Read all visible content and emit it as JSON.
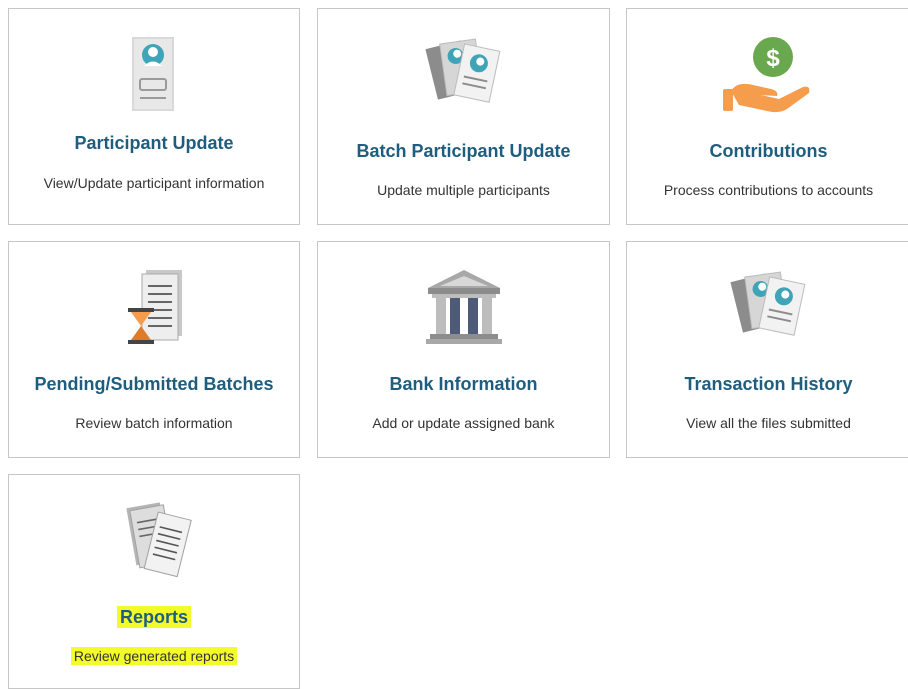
{
  "colors": {
    "title": "#1f5d7e",
    "description": "#333333",
    "border": "#c6c6c6",
    "highlight": "#f4fb2a",
    "teal": "#3fa4b8",
    "orange": "#f59c4d",
    "green": "#6aa84f"
  },
  "cards": [
    {
      "title": "Participant Update",
      "description": "View/Update participant information",
      "icon": "participant-profile-icon"
    },
    {
      "title": "Batch Participant Update",
      "description": "Update multiple participants",
      "icon": "batch-profiles-icon"
    },
    {
      "title": "Contributions",
      "description": "Process contributions to accounts",
      "icon": "hand-dollar-icon"
    },
    {
      "title": "Pending/Submitted Batches",
      "description": "Review batch information",
      "icon": "hourglass-document-icon"
    },
    {
      "title": "Bank Information",
      "description": "Add or update assigned bank",
      "icon": "bank-building-icon"
    },
    {
      "title": "Transaction History",
      "description": "View all the files submitted",
      "icon": "file-stack-icon"
    },
    {
      "title": "Reports",
      "description": "Review generated reports",
      "icon": "reports-documents-icon"
    }
  ]
}
